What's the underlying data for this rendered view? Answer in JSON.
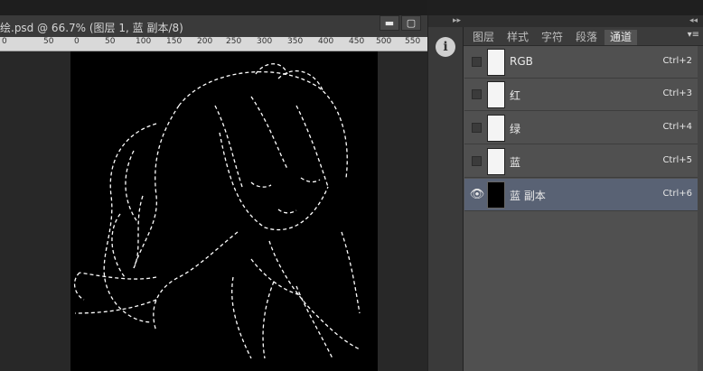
{
  "document": {
    "title": "绘.psd @ 66.7% (图层 1, 蓝 副本/8)",
    "ruler_labels": [
      "0",
      "50",
      "0",
      "50",
      "100",
      "150",
      "200",
      "250",
      "300",
      "350",
      "400",
      "450",
      "500",
      "550"
    ]
  },
  "window_buttons": {
    "minimize": "▬",
    "restore": "▢",
    "close": "✕"
  },
  "panel": {
    "collapse_label": "◂◂",
    "tabs": [
      {
        "label": "图层",
        "active": false
      },
      {
        "label": "样式",
        "active": false
      },
      {
        "label": "字符",
        "active": false
      },
      {
        "label": "段落",
        "active": false
      },
      {
        "label": "通道",
        "active": true
      }
    ],
    "menu_icon": "▾≡",
    "channels": [
      {
        "name": "RGB",
        "shortcut": "Ctrl+2",
        "visible": false,
        "selected": false
      },
      {
        "name": "红",
        "shortcut": "Ctrl+3",
        "visible": false,
        "selected": false
      },
      {
        "name": "绿",
        "shortcut": "Ctrl+4",
        "visible": false,
        "selected": false
      },
      {
        "name": "蓝",
        "shortcut": "Ctrl+5",
        "visible": false,
        "selected": false
      },
      {
        "name": "蓝 副本",
        "shortcut": "Ctrl+6",
        "visible": true,
        "selected": true
      }
    ]
  },
  "strip": {
    "expand_label": "▸▸",
    "info_icon": "info-icon"
  },
  "colors": {
    "selected_row": "#596274",
    "panel_bg": "#505050"
  }
}
